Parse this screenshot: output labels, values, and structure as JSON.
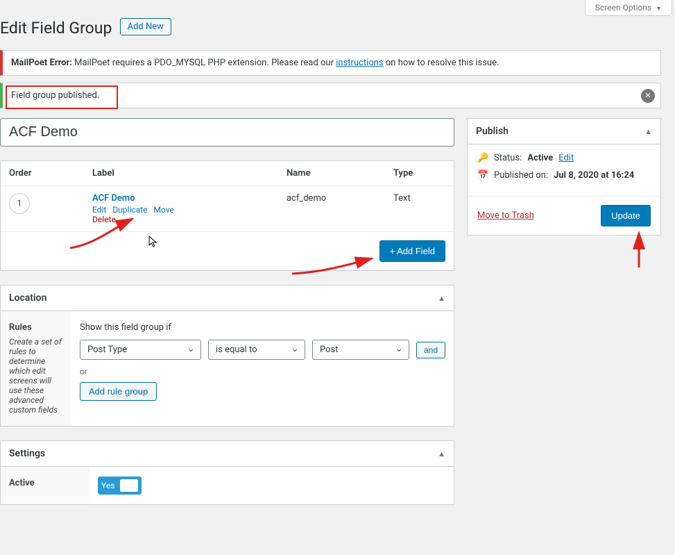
{
  "screen_options_label": "Screen Options",
  "page_title": "Edit Field Group",
  "add_new_label": "Add New",
  "mailpoet": {
    "prefix": "MailPoet Error:",
    "text1": " MailPoet requires a PDO_MYSQL PHP extension. Please read our ",
    "link": "instructions",
    "text2": " on how to resolve this issue."
  },
  "published_notice": "Field group published.",
  "title_value": "ACF Demo",
  "fields": {
    "headers": {
      "order": "Order",
      "label": "Label",
      "name": "Name",
      "type": "Type"
    },
    "row": {
      "order": "1",
      "label": "ACF Demo",
      "name": "acf_demo",
      "type": "Text",
      "actions": {
        "edit": "Edit",
        "duplicate": "Duplicate",
        "move": "Move",
        "delete": "Delete"
      }
    },
    "add_field": "+ Add Field"
  },
  "location": {
    "title": "Location",
    "rules_heading": "Rules",
    "rules_desc": "Create a set of rules to determine which edit screens will use these advanced custom fields",
    "show_text": "Show this field group if",
    "param": "Post Type",
    "operator": "is equal to",
    "value": "Post",
    "and": "and",
    "or": "or",
    "add_rule_group": "Add rule group"
  },
  "settings": {
    "title": "Settings",
    "active_label": "Active",
    "active_value": "Yes"
  },
  "publish": {
    "title": "Publish",
    "status_key": "Status:",
    "status_val": "Active",
    "edit": "Edit",
    "published_on": "Published on:",
    "published_date": "Jul 8, 2020 at 16:24",
    "trash": "Move to Trash",
    "update": "Update"
  }
}
